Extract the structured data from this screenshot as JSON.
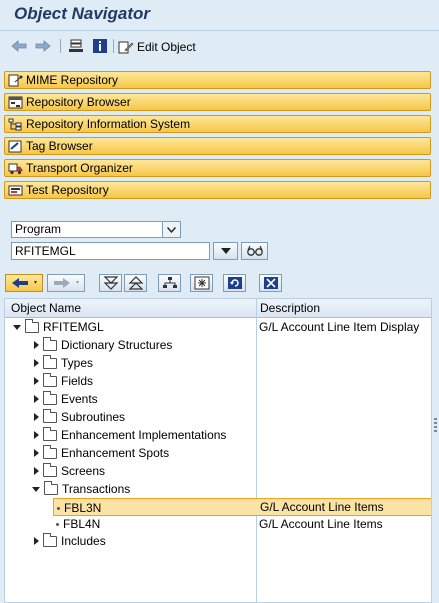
{
  "window": {
    "title": "Object Navigator"
  },
  "toolbar": {
    "back_icon": "arrow-left-icon",
    "forward_icon": "arrow-right-icon",
    "edit_object_label": "Edit Object"
  },
  "nav_buttons": [
    {
      "label": "MIME Repository",
      "icon": "mime-icon"
    },
    {
      "label": "Repository Browser",
      "icon": "browser-icon"
    },
    {
      "label": "Repository Information System",
      "icon": "info-system-icon"
    },
    {
      "label": "Tag Browser",
      "icon": "tag-icon"
    },
    {
      "label": "Transport Organizer",
      "icon": "truck-icon"
    },
    {
      "label": "Test Repository",
      "icon": "test-icon"
    }
  ],
  "selector": {
    "object_type": "Program",
    "object_name": "RFITEMGL"
  },
  "tree": {
    "col_name": "Object Name",
    "col_description": "Description",
    "root": {
      "name": "RFITEMGL",
      "description": "G/L Account Line Item Display"
    },
    "nodes": [
      {
        "name": "Dictionary Structures"
      },
      {
        "name": "Types"
      },
      {
        "name": "Fields"
      },
      {
        "name": "Events"
      },
      {
        "name": "Subroutines"
      },
      {
        "name": "Enhancement Implementations"
      },
      {
        "name": "Enhancement Spots"
      },
      {
        "name": "Screens"
      },
      {
        "name": "Transactions"
      }
    ],
    "transactions": [
      {
        "name": "FBL3N",
        "description": "G/L Account Line Items",
        "selected": true
      },
      {
        "name": "FBL4N",
        "description": "G/L Account Line Items",
        "selected": false
      }
    ],
    "last_node": {
      "name": "Includes"
    }
  },
  "colors": {
    "accent": "#f6c64a",
    "highlight": "#fbe3a6",
    "background": "#dfebf5"
  }
}
